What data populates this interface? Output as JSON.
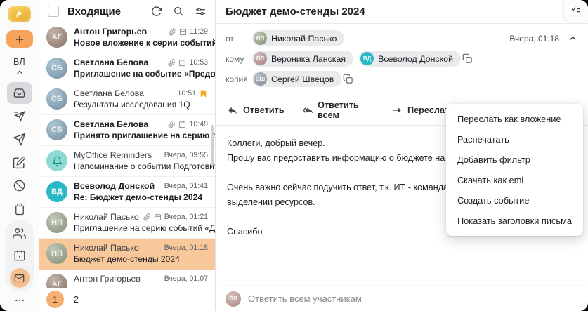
{
  "colors": {
    "accent_orange": "#F6A45B",
    "selection_orange": "#F8C89B",
    "flag_orange": "#F5A623",
    "teal_avatar": "#29B8C6",
    "chip_gray": "#E9EBED"
  },
  "sidebar": {
    "profile_initials": "ВЛ"
  },
  "list": {
    "title": "Входящие",
    "pages": [
      "1",
      "2"
    ],
    "emails": [
      {
        "sender": "Антон Григорьев",
        "subject": "Новое вложение к серии событий «Аналити...",
        "time": "11:29",
        "unread": true,
        "attachment": true,
        "calendar": true,
        "flagged": false,
        "selected": false,
        "avatar": {
          "initials": "АГ",
          "bg": "#9C8273",
          "photo": true
        }
      },
      {
        "sender": "Светлана Белова",
        "subject": "Приглашение на событие «Предварительно...",
        "time": "10:53",
        "unread": true,
        "attachment": true,
        "calendar": true,
        "flagged": false,
        "selected": false,
        "avatar": {
          "initials": "СБ",
          "bg": "#7FA3B8",
          "photo": true
        }
      },
      {
        "sender": "Светлана Белова",
        "subject": "Результаты исследования 1Q",
        "time": "10:51",
        "unread": false,
        "attachment": false,
        "calendar": false,
        "flagged": true,
        "selected": false,
        "avatar": {
          "initials": "СБ",
          "bg": "#7FA3B8",
          "photo": true
        }
      },
      {
        "sender": "Светлана Белова",
        "subject": "Принято приглашение на серию событий «...",
        "time": "10:49",
        "unread": true,
        "attachment": true,
        "calendar": true,
        "flagged": false,
        "selected": false,
        "avatar": {
          "initials": "СБ",
          "bg": "#7FA3B8",
          "photo": true
        }
      },
      {
        "sender": "MyOffice Reminders",
        "subject": "Напоминание о событии Подготовить отчет...",
        "time": "Вчера, 09:55",
        "unread": false,
        "attachment": false,
        "calendar": false,
        "flagged": false,
        "selected": false,
        "avatar": {
          "type": "bell",
          "bg": "#8FD9D4"
        }
      },
      {
        "sender": "Всеволод Донской",
        "subject": "Re: Бюджет демо-стенды 2024",
        "time": "Вчера, 01:41",
        "unread": true,
        "attachment": false,
        "calendar": false,
        "flagged": false,
        "selected": false,
        "avatar": {
          "initials": "ВД",
          "bg": "#29B8C6"
        }
      },
      {
        "sender": "Николай Пасько",
        "subject": "Приглашение на серию событий «Демо стен...",
        "time": "Вчера, 01:21",
        "unread": false,
        "attachment": true,
        "calendar": true,
        "flagged": false,
        "selected": false,
        "avatar": {
          "initials": "НП",
          "bg": "#97A386",
          "photo": true
        }
      },
      {
        "sender": "Николай Пасько",
        "subject": "Бюджет демо-стенды 2024",
        "time": "Вчера, 01:18",
        "unread": false,
        "attachment": false,
        "calendar": false,
        "flagged": false,
        "selected": true,
        "avatar": {
          "initials": "НП",
          "bg": "#97A386",
          "photo": true
        }
      },
      {
        "sender": "Антон Григорьев",
        "subject": "",
        "time": "Вчера, 01:07",
        "unread": false,
        "attachment": false,
        "calendar": false,
        "flagged": false,
        "selected": false,
        "avatar": {
          "initials": "АГ",
          "bg": "#9C8273",
          "photo": true
        }
      }
    ]
  },
  "message": {
    "subject": "Бюджет демо-стенды 2024",
    "date": "Вчера, 01:18",
    "from_label": "от",
    "to_label": "кому",
    "cc_label": "копия",
    "from": [
      {
        "name": "Николай Пасько",
        "initials": "НП",
        "bg": "#97A386",
        "photo": true
      }
    ],
    "to": [
      {
        "name": "Вероника Ланская",
        "initials": "ВЛ",
        "bg": "#B88F8F",
        "photo": true
      },
      {
        "name": "Всеволод Донской",
        "initials": "ВД",
        "bg": "#29B8C6"
      }
    ],
    "cc": [
      {
        "name": "Сергей Швецов",
        "initials": "СШ",
        "bg": "#8E9BAA",
        "photo": true
      }
    ],
    "actions": {
      "reply": "Ответить",
      "reply_all": "Ответить всем",
      "forward": "Переслать"
    },
    "body_lines": [
      "Коллеги, добрый вечер.",
      "Прошу вас предоставить информацию о бюджете на наши демонстраци",
      "",
      "Очень важно сейчас подучить ответ, т.к. ИТ - команда Всеволода, уже",
      "выделении ресурсов.",
      "",
      "Спасибо"
    ],
    "reply_placeholder": "Ответить всем участникам",
    "reply_avatar": {
      "initials": "ВЛ",
      "bg": "#C19A92"
    }
  },
  "context_menu": {
    "items": [
      "Переслать как вложение",
      "Распечатать",
      "Добавить фильтр",
      "Скачать как eml",
      "Создать событие",
      "Показать заголовки письма"
    ]
  }
}
